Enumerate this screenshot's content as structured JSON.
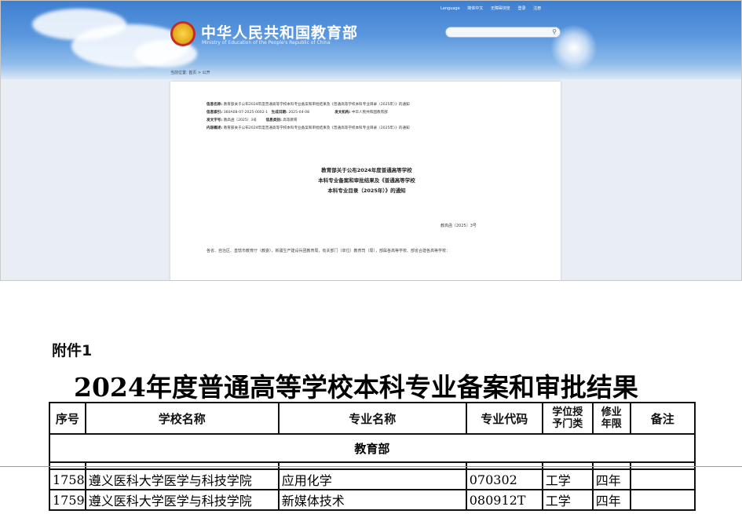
{
  "header": {
    "site_title": "中华人民共和国教育部",
    "site_subtitle": "Ministry of Education of the People's Republic of China",
    "top_links": [
      "Language",
      "简体中文",
      "无障碍浏览",
      "登录",
      "注册"
    ]
  },
  "breadcrumb": "当前位置: 首页 > 公开",
  "document": {
    "meta": [
      {
        "k": "信息名称:",
        "v": "教育部关于公布2024年度普通高等学校本科专业备案和审批结果及《普通高等学校本科专业目录（2025年）》的通知"
      },
      {
        "k": "信息索引:",
        "v": "360A08-07-2025-0002-1",
        "k2": "生成日期:",
        "v2": "2025-04-08",
        "k3": "发文机构:",
        "v3": "中华人民共和国教育部"
      },
      {
        "k": "发文字号:",
        "v": "教高函〔2025〕3号",
        "k2": "信息类别:",
        "v2": "高等教育"
      },
      {
        "k": "内容概述:",
        "v": "教育部关于公布2024年度普通高等学校本科专业备案和审批结果及《普通高等学校本科专业目录（2025年）》的通知"
      }
    ],
    "title_lines": [
      "教育部关于公布2024年度普通高等学校",
      "本科专业备案和审批结果及《普通高等学校",
      "本科专业目录（2025年）》的通知"
    ],
    "doc_number": "教高函〔2025〕3号",
    "body": "各省、自治区、直辖市教育厅（教委），新疆生产建设兵团教育局，有关部门（单位）教育司（局），部属各高等学校、部省合建各高等学校："
  },
  "attachment": {
    "label": "附件1",
    "title": "2024年度普通高等学校本科专业备案和审批结果",
    "columns": [
      "序号",
      "学校名称",
      "专业名称",
      "专业代码",
      "学位授予门类",
      "修业年限",
      "备注"
    ],
    "column_lines": {
      "degree": [
        "学位授",
        "予门类"
      ],
      "years": [
        "修业",
        "年限"
      ]
    },
    "group": "教育部",
    "rows": [
      {
        "no": "1758",
        "school": "遵义医科大学医学与科技学院",
        "major": "应用化学",
        "code": "070302",
        "degree": "工学",
        "years": "四年",
        "note": ""
      },
      {
        "no": "1759",
        "school": "遵义医科大学医学与科技学院",
        "major": "新媒体技术",
        "code": "080912T",
        "degree": "工学",
        "years": "四年",
        "note": ""
      }
    ]
  }
}
